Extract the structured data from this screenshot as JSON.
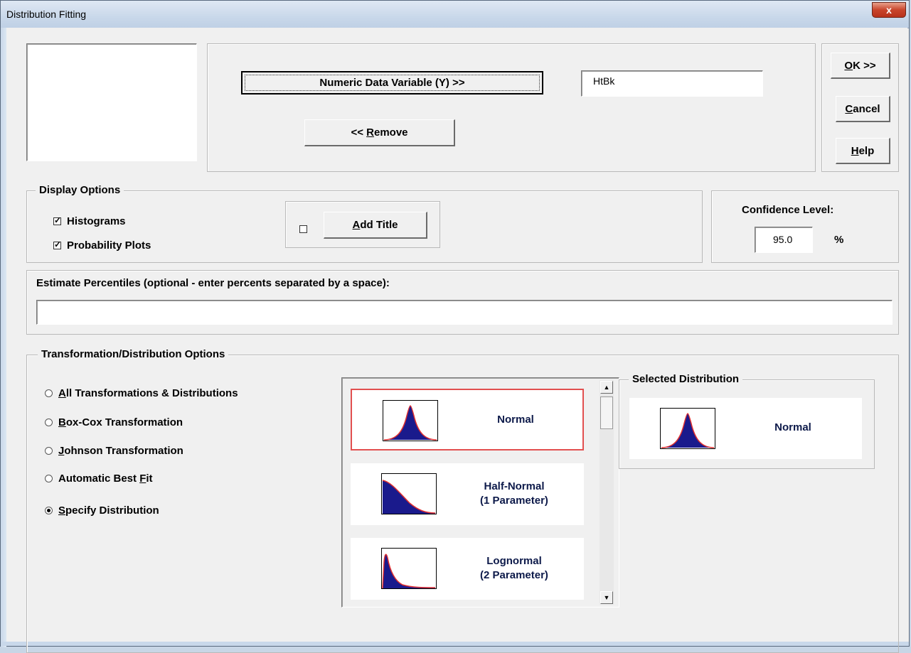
{
  "window": {
    "title": "Distribution Fitting",
    "close_glyph": "x"
  },
  "variables": {
    "numeric_button": "Numeric Data Variable (Y) >>",
    "numeric_value": "HtBk",
    "remove_pre": "<< ",
    "remove_key": "R",
    "remove_post": "emove"
  },
  "side_buttons": {
    "ok_key": "O",
    "ok_rest": "K >>",
    "cancel_key": "C",
    "cancel_rest": "ancel",
    "help_key": "H",
    "help_rest": "elp"
  },
  "display_options": {
    "label": "Display Options",
    "histograms": {
      "label": "Histograms",
      "checked": true
    },
    "probability_plots": {
      "label": "Probability Plots",
      "checked": true
    },
    "add_title_checked": false,
    "add_title_key": "A",
    "add_title_rest": "dd Title"
  },
  "confidence": {
    "label": "Confidence Level:",
    "value": "95.0",
    "unit": "%"
  },
  "percentiles": {
    "label": "Estimate Percentiles (optional - enter percents separated by a space):",
    "value": ""
  },
  "transformation": {
    "label": "Transformation/Distribution Options",
    "options": [
      {
        "key": "A",
        "rest": "ll Transformations & Distributions",
        "selected": false
      },
      {
        "key": "B",
        "rest": "ox-Cox Transformation",
        "selected": false
      },
      {
        "key": "J",
        "rest": "ohnson Transformation",
        "selected": false
      },
      {
        "pre": "Automatic Best ",
        "key": "F",
        "rest": "it",
        "selected": false
      },
      {
        "key": "S",
        "rest": "pecify Distribution",
        "selected": true
      }
    ],
    "distributions": [
      {
        "line1": "Normal",
        "line2": "",
        "curve": "normal-curve-icon",
        "selected": true
      },
      {
        "line1": "Half-Normal",
        "line2": "(1 Parameter)",
        "curve": "half-normal-curve-icon",
        "selected": false
      },
      {
        "line1": "Lognormal",
        "line2": "(2 Parameter)",
        "curve": "lognormal-curve-icon",
        "selected": false
      }
    ],
    "selected_distribution": {
      "label": "Selected Distribution",
      "name": "Normal"
    }
  },
  "colors": {
    "curve_fill": "#1a1a8c",
    "curve_line": "#e03030",
    "selection_border": "#e25050"
  }
}
